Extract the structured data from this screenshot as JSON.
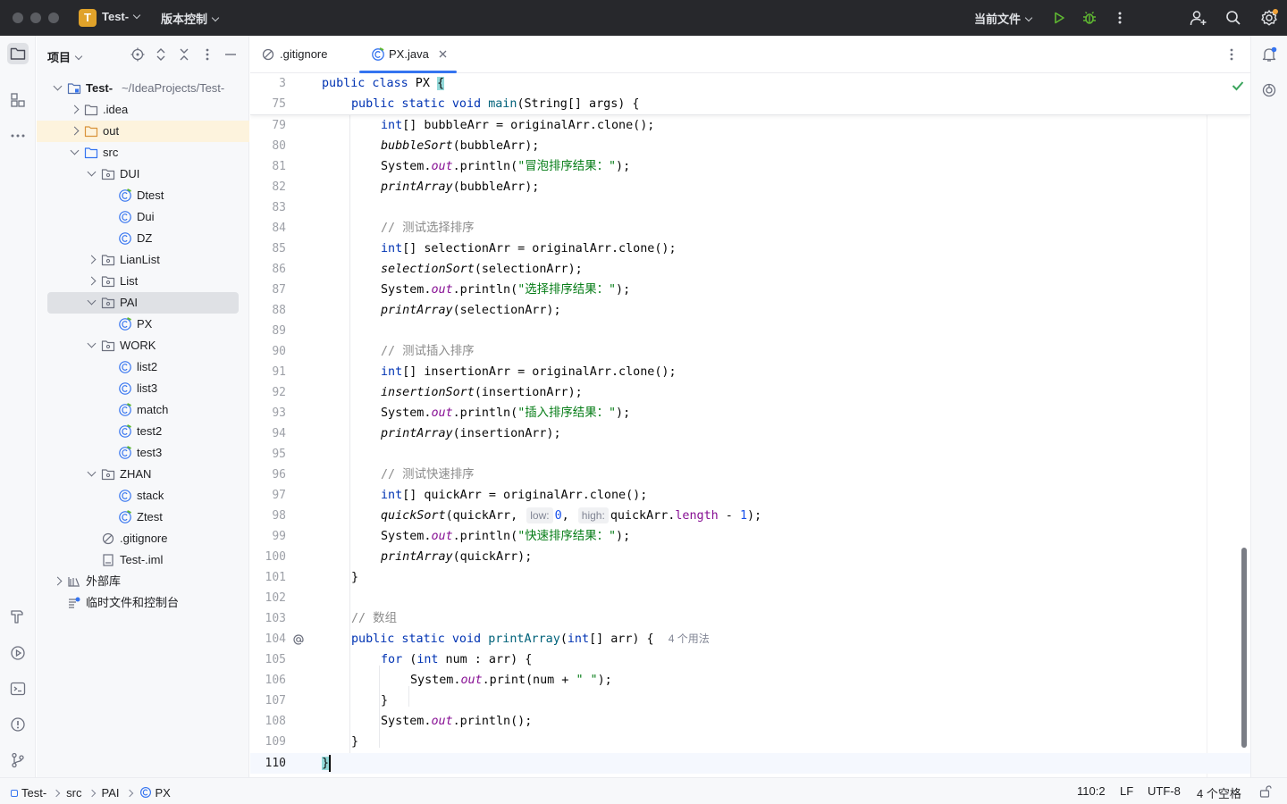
{
  "titlebar": {
    "project_initial": "T",
    "project_name": "Test-",
    "vcs_label": "版本控制",
    "run_config": "当前文件"
  },
  "project_panel": {
    "title": "项目",
    "tree": [
      {
        "label": "Test-",
        "path": "~/IdeaProjects/Test-",
        "level": 0,
        "expanded": true,
        "icon": "module-folder-icon"
      },
      {
        "label": ".idea",
        "level": 1,
        "expanded": false,
        "icon": "folder-icon"
      },
      {
        "label": "out",
        "level": 1,
        "expanded": false,
        "icon": "excluded-folder-icon"
      },
      {
        "label": "src",
        "level": 1,
        "expanded": true,
        "icon": "source-folder-icon"
      },
      {
        "label": "DUI",
        "level": 2,
        "expanded": true,
        "icon": "package-icon"
      },
      {
        "label": "Dtest",
        "level": 3,
        "icon": "runnable-class-icon"
      },
      {
        "label": "Dui",
        "level": 3,
        "icon": "class-icon"
      },
      {
        "label": "DZ",
        "level": 3,
        "icon": "class-icon"
      },
      {
        "label": "LianList",
        "level": 2,
        "expanded": false,
        "icon": "package-icon"
      },
      {
        "label": "List",
        "level": 2,
        "expanded": false,
        "icon": "package-icon"
      },
      {
        "label": "PAI",
        "level": 2,
        "expanded": true,
        "icon": "package-icon"
      },
      {
        "label": "PX",
        "level": 3,
        "icon": "runnable-class-icon"
      },
      {
        "label": "WORK",
        "level": 2,
        "expanded": true,
        "icon": "package-icon"
      },
      {
        "label": "list2",
        "level": 3,
        "icon": "class-icon"
      },
      {
        "label": "list3",
        "level": 3,
        "icon": "class-icon"
      },
      {
        "label": "match",
        "level": 3,
        "icon": "runnable-class-icon"
      },
      {
        "label": "test2",
        "level": 3,
        "icon": "runnable-class-icon"
      },
      {
        "label": "test3",
        "level": 3,
        "icon": "runnable-class-icon"
      },
      {
        "label": "ZHAN",
        "level": 2,
        "expanded": true,
        "icon": "package-icon"
      },
      {
        "label": "stack",
        "level": 3,
        "icon": "class-icon"
      },
      {
        "label": "Ztest",
        "level": 3,
        "icon": "runnable-class-icon"
      },
      {
        "label": ".gitignore",
        "level": 2,
        "icon": "ignore-file-icon"
      },
      {
        "label": "Test-.iml",
        "level": 2,
        "icon": "iml-file-icon"
      },
      {
        "label": "外部库",
        "level": 0,
        "expanded": false,
        "icon": "library-icon"
      },
      {
        "label": "临时文件和控制台",
        "level": 0,
        "icon": "scratch-icon"
      }
    ]
  },
  "tabs": [
    {
      "label": ".gitignore",
      "active": false
    },
    {
      "label": "PX.java",
      "active": true
    }
  ],
  "editor": {
    "sticky_lines": [
      "3",
      "75"
    ],
    "line_numbers": [
      "79",
      "80",
      "81",
      "82",
      "83",
      "84",
      "85",
      "86",
      "87",
      "88",
      "89",
      "90",
      "91",
      "92",
      "93",
      "94",
      "95",
      "96",
      "97",
      "98",
      "99",
      "100",
      "101",
      "102",
      "103",
      "104",
      "105",
      "106",
      "107",
      "108",
      "109",
      "110"
    ],
    "hint_low": "low:",
    "hint_high": "high:",
    "usages": "4 个用法",
    "strings": {
      "bubble": "\"冒泡排序结果：\"",
      "selection": "\"选择排序结果：\"",
      "insertion": "\"插入排序结果：\"",
      "quick": "\"快速排序结果：\"",
      "space": "\" \""
    },
    "comments": {
      "selection": "// 测试选择排序",
      "insertion": "// 测试插入排序",
      "quick": "// 测试快速排序",
      "array": "// 数组"
    }
  },
  "statusbar": {
    "breadcrumb": [
      "Test-",
      "src",
      "PAI",
      "PX"
    ],
    "position": "110:2",
    "line_sep": "LF",
    "encoding": "UTF-8",
    "indent": "4 个空格"
  },
  "colors": {
    "accent": "#3574f0",
    "keyword": "#0033b3",
    "string": "#067d17",
    "field": "#871094",
    "comment": "#8c8c8c",
    "number": "#1750eb",
    "success": "#3ba55d",
    "debug": "#5fb832"
  }
}
